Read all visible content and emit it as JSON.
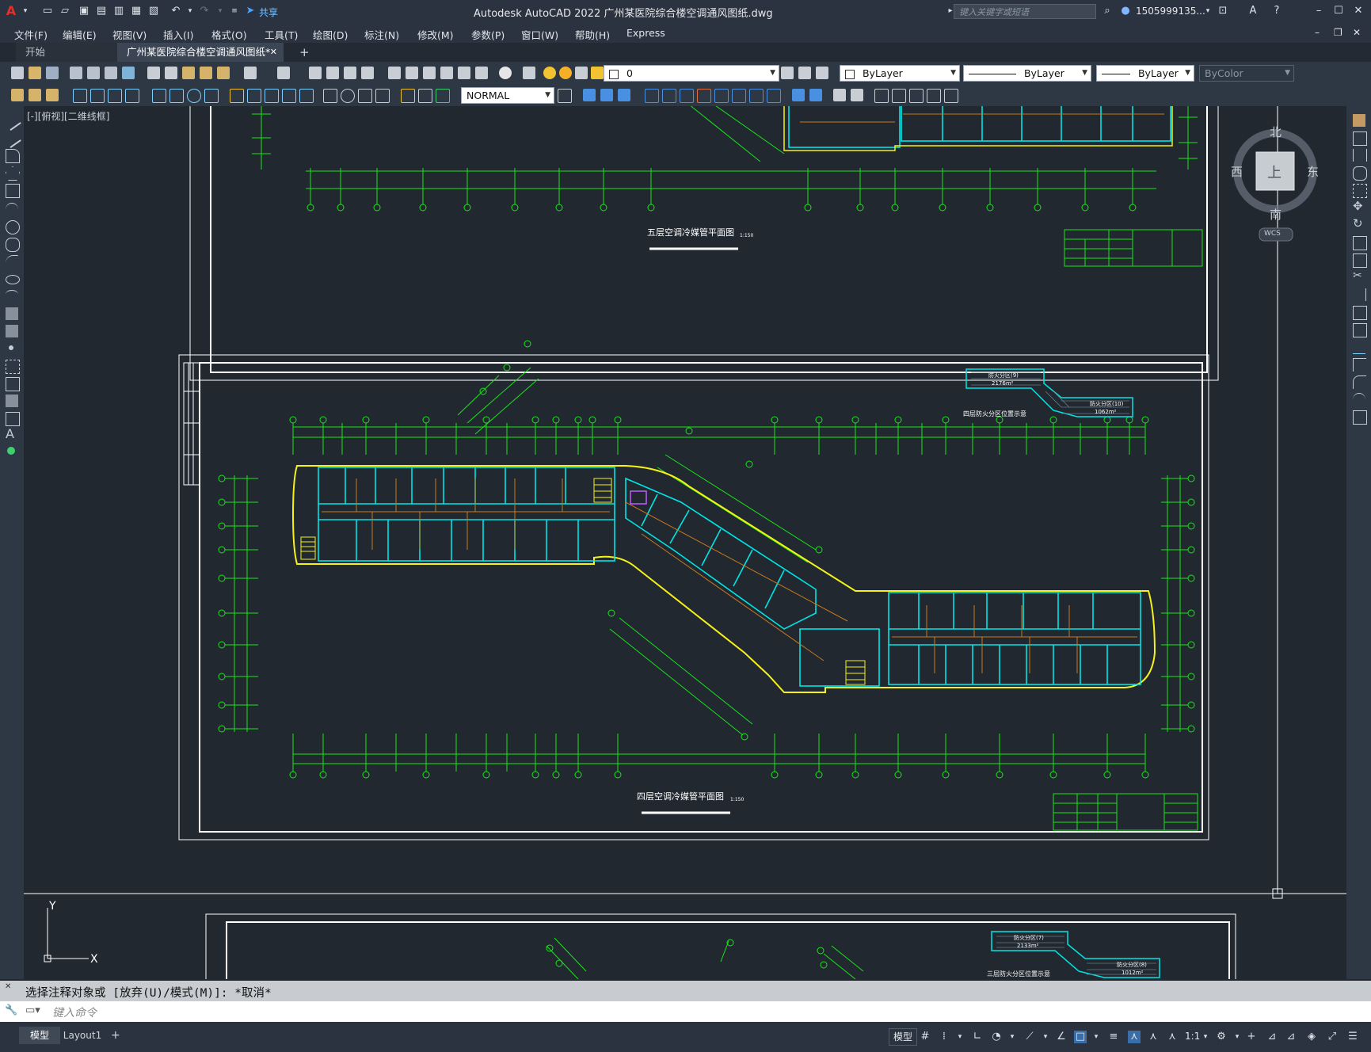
{
  "app": {
    "title": "Autodesk AutoCAD 2022    广州某医院综合楼空调通风图纸.dwg",
    "search_placeholder": "键入关键字或短语",
    "user": "1505999135...",
    "share_label": "共享"
  },
  "menu": [
    "文件(F)",
    "编辑(E)",
    "视图(V)",
    "插入(I)",
    "格式(O)",
    "工具(T)",
    "绘图(D)",
    "标注(N)",
    "修改(M)",
    "参数(P)",
    "窗口(W)",
    "帮助(H)",
    "Express"
  ],
  "tabs": [
    {
      "label": "开始",
      "active": false
    },
    {
      "label": "广州某医院综合楼空调通风图纸*",
      "active": true
    }
  ],
  "layer_combo": "0",
  "properties": {
    "color": "ByLayer",
    "linetype": "ByLayer",
    "lineweight": "ByLayer",
    "plotstyle": "ByColor"
  },
  "dimstyle_combo": "NORMAL",
  "viewport_label": "[-][俯视][二维线框]",
  "viewcube": {
    "north": "北",
    "south": "南",
    "west": "西",
    "east": "东",
    "face": "上",
    "wcs": "WCS"
  },
  "drawings": {
    "upper_title": "五层空调冷媒管平面图",
    "upper_scale": "1:150",
    "main_title": "四层空调冷媒管平面图",
    "main_scale": "1:150",
    "fire_zone_1": "防火分区(9)",
    "fire_zone_1_area": "2176m²",
    "fire_zone_2": "防火分区(10)",
    "fire_zone_2_area": "1062m²",
    "fire_zone_caption": "四层防火分区位置示意",
    "lower_zone_1": "防火分区(7)",
    "lower_zone_1_area": "2133m²",
    "lower_zone_2": "防火分区(8)",
    "lower_zone_2_area": "1012m²",
    "lower_caption": "三层防火分区位置示意"
  },
  "ucs": {
    "x": "X",
    "y": "Y"
  },
  "command": {
    "history": "选择注释对象或 [放弃(U)/模式(M)]: *取消*",
    "placeholder": "键入命令"
  },
  "layout_tabs": [
    "模型",
    "Layout1"
  ],
  "status": {
    "model_label": "模型",
    "scale": "1:1"
  }
}
